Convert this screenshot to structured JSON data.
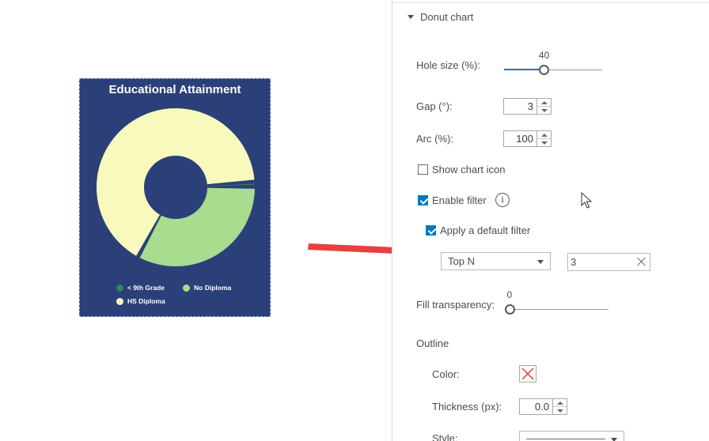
{
  "chart": {
    "title": "Educational Attainment",
    "legend": [
      {
        "label": "< 9th Grade",
        "color": "#2e8b57"
      },
      {
        "label": "No Diploma",
        "color": "#a8dc8f"
      },
      {
        "label": "HS Diploma",
        "color": "#f7f9bd"
      }
    ],
    "background": "#2b4079"
  },
  "chart_data": {
    "type": "pie",
    "title": "Educational Attainment",
    "categories": [
      "< 9th Grade",
      "No Diploma",
      "HS Diploma"
    ],
    "values": [
      1,
      33,
      66
    ],
    "colors": [
      "#2e8b57",
      "#a8dc8f",
      "#f7f9bd"
    ],
    "hole_size_percent": 40,
    "gap_degrees": 3,
    "legend_position": "bottom"
  },
  "panel": {
    "section_title": "Donut chart",
    "hole_size": {
      "label": "Hole size (%):",
      "value": "40",
      "fraction": 0.4
    },
    "gap": {
      "label": "Gap (°):",
      "value": "3"
    },
    "arc": {
      "label": "Arc (%):",
      "value": "100"
    },
    "show_chart_icon": {
      "label": "Show chart icon",
      "checked": false
    },
    "enable_filter": {
      "label": "Enable filter",
      "checked": true
    },
    "apply_default_filter": {
      "label": "Apply a default filter",
      "checked": true
    },
    "filter_type": {
      "value": "Top N"
    },
    "filter_value": {
      "value": "3"
    },
    "fill_transparency": {
      "label": "Fill transparency:",
      "value": "0",
      "fraction": 0
    },
    "outline": {
      "title": "Outline",
      "color_label": "Color:",
      "thickness_label": "Thickness (px):",
      "thickness_value": "0.0",
      "style_label": "Style:"
    }
  },
  "colors": {
    "accent": "#0079c1",
    "arrow": "#e8403f",
    "slider_fill": "#2b6fae"
  },
  "icons": {
    "section_toggle": "caret-down-icon",
    "info": "info-icon",
    "clear": "close-icon",
    "no_color": "no-color-icon",
    "cursor": "mouse-pointer-icon"
  }
}
